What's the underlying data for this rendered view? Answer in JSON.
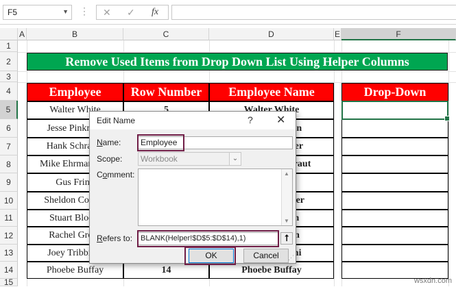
{
  "formula_bar": {
    "name_box": "F5",
    "fx_icon": "fx",
    "cancel_icon": "✕",
    "enter_icon": "✓"
  },
  "columns": [
    "A",
    "B",
    "C",
    "D",
    "E",
    "F"
  ],
  "rows": [
    "1",
    "2",
    "3",
    "4",
    "5",
    "6",
    "7",
    "8",
    "9",
    "10",
    "11",
    "12",
    "13",
    "14",
    "15"
  ],
  "banner": "Remove Used Items from Drop Down List Using Helper Columns",
  "headers": {
    "employee": "Employee",
    "row_number": "Row Number",
    "employee_name": "Employee Name",
    "drop_down": "Drop-Down"
  },
  "table": [
    {
      "employee": "Walter White",
      "row": "5",
      "name": "Walter White"
    },
    {
      "employee": "Jesse Pinkman",
      "row": "",
      "name": "Jesse Pinkman"
    },
    {
      "employee": "Hank Schrader",
      "row": "",
      "name": "Hank Schrader"
    },
    {
      "employee": "Mike Ehrmantraut",
      "row": "",
      "name": "Mike Ehrmantraut"
    },
    {
      "employee": "Gus Fring",
      "row": "",
      "name": ""
    },
    {
      "employee": "Sheldon Cooper",
      "row": "",
      "name": "Sheldon Cooper"
    },
    {
      "employee": "Stuart Bloom",
      "row": "",
      "name": "Stuart Bloom"
    },
    {
      "employee": "Rachel Green",
      "row": "",
      "name": "Rachel Green"
    },
    {
      "employee": "Joey Tribbiani",
      "row": "",
      "name": "Joey Tribbiani"
    },
    {
      "employee": "Phoebe Buffay",
      "row": "14",
      "name": "Phoebe Buffay"
    }
  ],
  "dialog": {
    "title": "Edit Name",
    "help": "?",
    "close": "✕",
    "name_label_u": "N",
    "name_label_rest": "ame:",
    "name_value": "Employee",
    "scope_label": "Scope:",
    "scope_value": "Workbook",
    "comment_label_pre": "C",
    "comment_label_u": "o",
    "comment_label_rest": "mment:",
    "refers_label_u": "R",
    "refers_label_rest": "efers to:",
    "refers_value": "BLANK(Helper!$D$5:$D$14),1)",
    "ok": "OK",
    "cancel": "Cancel"
  },
  "watermark": "wsxdn.com"
}
